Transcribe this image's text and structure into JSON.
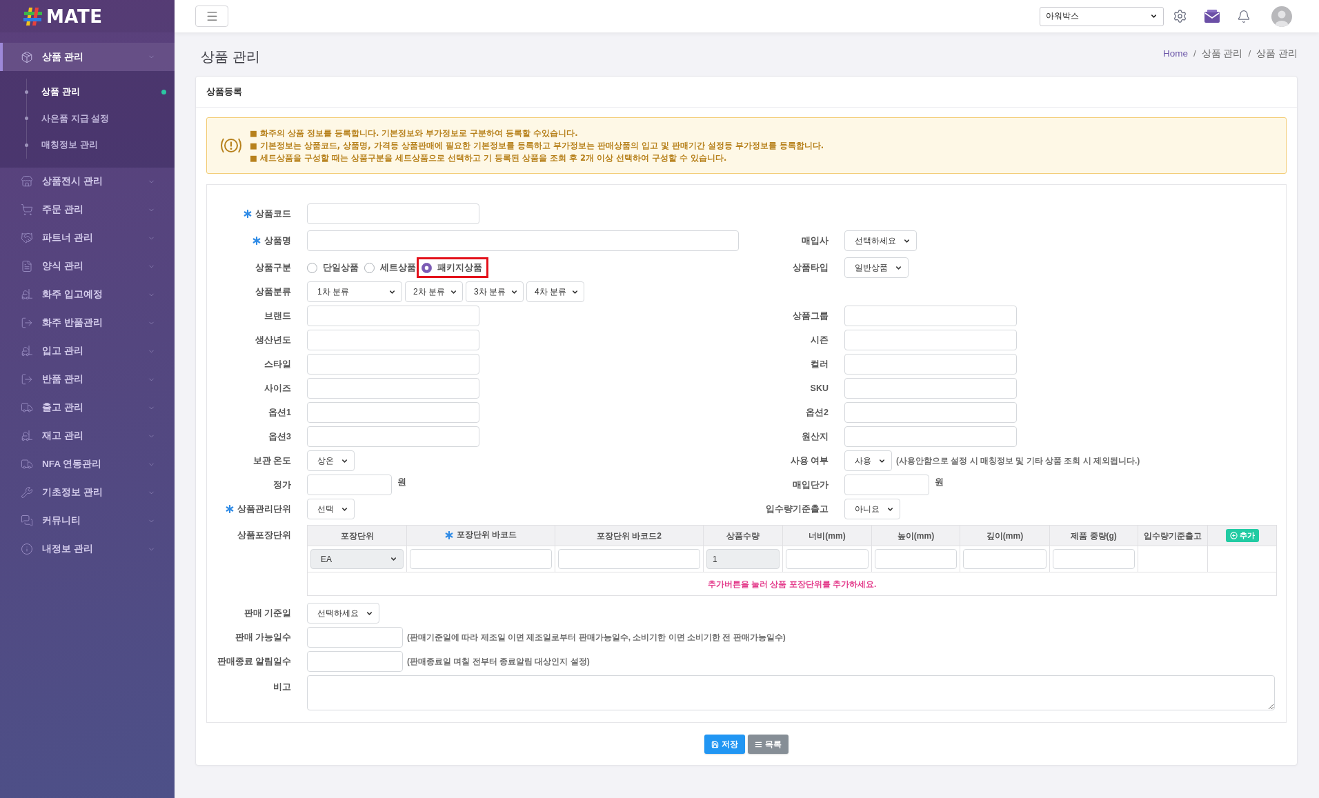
{
  "sidebar": {
    "logo": "MATE",
    "items": [
      {
        "label": "상품 관리",
        "selected": true,
        "children": [
          {
            "label": "상품 관리",
            "selected": true
          },
          {
            "label": "사은품 지급 설정",
            "selected": false
          },
          {
            "label": "매칭정보 관리",
            "selected": false
          }
        ]
      },
      {
        "label": "상품전시 관리",
        "selected": false
      },
      {
        "label": "주문 관리",
        "selected": false
      },
      {
        "label": "파트너 관리",
        "selected": false
      },
      {
        "label": "양식 관리",
        "selected": false
      },
      {
        "label": "화주 입고예정",
        "selected": false
      },
      {
        "label": "화주 반품관리",
        "selected": false
      },
      {
        "label": "입고 관리",
        "selected": false
      },
      {
        "label": "반품 관리",
        "selected": false
      },
      {
        "label": "출고 관리",
        "selected": false
      },
      {
        "label": "재고 관리",
        "selected": false
      },
      {
        "label": "NFA 연동관리",
        "selected": false
      },
      {
        "label": "기초정보 관리",
        "selected": false
      },
      {
        "label": "커뮤니티",
        "selected": false
      },
      {
        "label": "내정보 관리",
        "selected": false
      }
    ]
  },
  "topbar": {
    "company_select": {
      "value": "아워박스"
    }
  },
  "page": {
    "title": "상품 관리",
    "breadcrumb": [
      {
        "label": "Home",
        "link": true
      },
      {
        "separator": "/",
        "label": "상품 관리",
        "link": false
      },
      {
        "separator": "/",
        "label": "상품 관리",
        "link": false
      }
    ]
  },
  "card": {
    "title": "상품등록",
    "notice": [
      "■ 화주의 상품 정보를 등록합니다. 기본정보와 부가정보로 구분하여 등록할 수있습니다.",
      "■ 기본정보는 상품코드, 상품명, 가격등 상품판매에 필요한 기본정보를 등록하고 부가정보는 판매상품의 입고 및 판매기간 설정등 부가정보를 등록합니다.",
      "■ 세트상품을 구성할 때는 상품구분을 세트상품으로 선택하고 기 등록된 상품을 조회 후 2개 이상 선택하여 구성할 수 있습니다."
    ],
    "form": [
      {
        "left": {
          "label": "상품코드",
          "required": true,
          "kind": "text"
        }
      },
      {
        "left": {
          "label": "상품명",
          "required": true,
          "kind": "wide"
        },
        "right": {
          "label": "매입사",
          "required": false,
          "kind": "select",
          "value": "선택하세요"
        }
      },
      {
        "left": {
          "label": "상품구분",
          "required": false,
          "kind": "radio",
          "options": [
            {
              "label": "단일상품",
              "selected": false,
              "highlighted": false
            },
            {
              "label": "세트상품",
              "selected": false,
              "highlighted": false
            },
            {
              "label": "패키지상품",
              "selected": true,
              "highlighted": true
            }
          ]
        },
        "right": {
          "label": "상품타입",
          "required": false,
          "kind": "select",
          "value": "일반상품"
        }
      },
      {
        "left": {
          "label": "상품분류",
          "required": false,
          "kind": "selects",
          "values": [
            "1차 분류",
            "2차 분류",
            "3차 분류",
            "4차 분류"
          ]
        }
      },
      {
        "left": {
          "label": "브랜드",
          "required": false,
          "kind": "text"
        },
        "right": {
          "label": "상품그룹",
          "required": false,
          "kind": "text"
        }
      },
      {
        "left": {
          "label": "생산년도",
          "required": false,
          "kind": "text"
        },
        "right": {
          "label": "시즌",
          "required": false,
          "kind": "text"
        }
      },
      {
        "left": {
          "label": "스타일",
          "required": false,
          "kind": "text"
        },
        "right": {
          "label": "컬러",
          "required": false,
          "kind": "text"
        }
      },
      {
        "left": {
          "label": "사이즈",
          "required": false,
          "kind": "text"
        },
        "right": {
          "label": "SKU",
          "required": false,
          "kind": "text"
        }
      },
      {
        "left": {
          "label": "옵션1",
          "required": false,
          "kind": "text"
        },
        "right": {
          "label": "옵션2",
          "required": false,
          "kind": "text"
        }
      },
      {
        "left": {
          "label": "옵션3",
          "required": false,
          "kind": "text"
        },
        "right": {
          "label": "원산지",
          "required": false,
          "kind": "text"
        }
      },
      {
        "left": {
          "label": "보관 온도",
          "required": false,
          "kind": "select",
          "value": "상온"
        },
        "right": {
          "label": "사용 여부",
          "required": false,
          "kind": "select",
          "value": "사용",
          "note": "(사용안함으로 설정 시 매칭정보 및 기타 상품 조회 시 제외됩니다.)"
        }
      },
      {
        "left": {
          "label": "정가",
          "required": false,
          "kind": "amount",
          "unit": "원"
        },
        "right": {
          "label": "매입단가",
          "required": false,
          "kind": "amount",
          "unit": "원"
        }
      },
      {
        "left": {
          "label": "상품관리단위",
          "required": true,
          "kind": "select",
          "value": "선택"
        },
        "right": {
          "label": "입수량기준출고",
          "required": false,
          "kind": "select",
          "value": "아니요"
        }
      },
      {
        "left": {
          "label": "상품포장단위",
          "required": false,
          "kind": "table",
          "columns": [
            {
              "label": "포장단위",
              "required": false
            },
            {
              "label": "포장단위 바코드",
              "required": true
            },
            {
              "label": "포장단위 바코드2",
              "required": false
            },
            {
              "label": "상품수량",
              "required": false
            },
            {
              "label": "너비(mm)",
              "required": false
            },
            {
              "label": "높이(mm)",
              "required": false
            },
            {
              "label": "깊이(mm)",
              "required": false
            },
            {
              "label": "제품 중량(g)",
              "required": false
            },
            {
              "label": "입수량기준출고",
              "required": false
            }
          ],
          "add_button": {
            "label": "추가"
          },
          "cells": [
            {
              "kind": "select",
              "value": "EA",
              "disabled": true
            },
            {
              "kind": "input",
              "disabled": false
            },
            {
              "kind": "input",
              "disabled": false
            },
            {
              "kind": "input",
              "value": "1",
              "disabled": true
            },
            {
              "kind": "input",
              "disabled": false
            },
            {
              "kind": "input",
              "disabled": false
            },
            {
              "kind": "input",
              "disabled": false
            },
            {
              "kind": "input",
              "disabled": false
            },
            {
              "kind": "blank"
            },
            {
              "kind": "blank"
            }
          ],
          "message": "추가버튼을 눌러 상품 포장단위를 추가하세요."
        }
      },
      {
        "left": {
          "label": "판매 기준일",
          "required": false,
          "kind": "select",
          "value": "선택하세요"
        }
      },
      {
        "left": {
          "label": "판매 가능일수",
          "required": false,
          "kind": "days",
          "note": "(판매기준일에 따라 제조일 이면 제조일로부터 판매가능일수, 소비기한 이면 소비기한 전 판매가능일수)"
        }
      },
      {
        "left": {
          "label": "판매종료 알림일수",
          "required": false,
          "kind": "days",
          "note": "(판매종료일 며칠 전부터 종료알림 대상인지 설정)"
        }
      },
      {
        "left": {
          "label": "비고",
          "required": false,
          "kind": "textarea"
        }
      }
    ],
    "buttons": [
      {
        "label": "저장",
        "kind": "primary"
      },
      {
        "label": "목록",
        "kind": "secondary"
      }
    ]
  }
}
